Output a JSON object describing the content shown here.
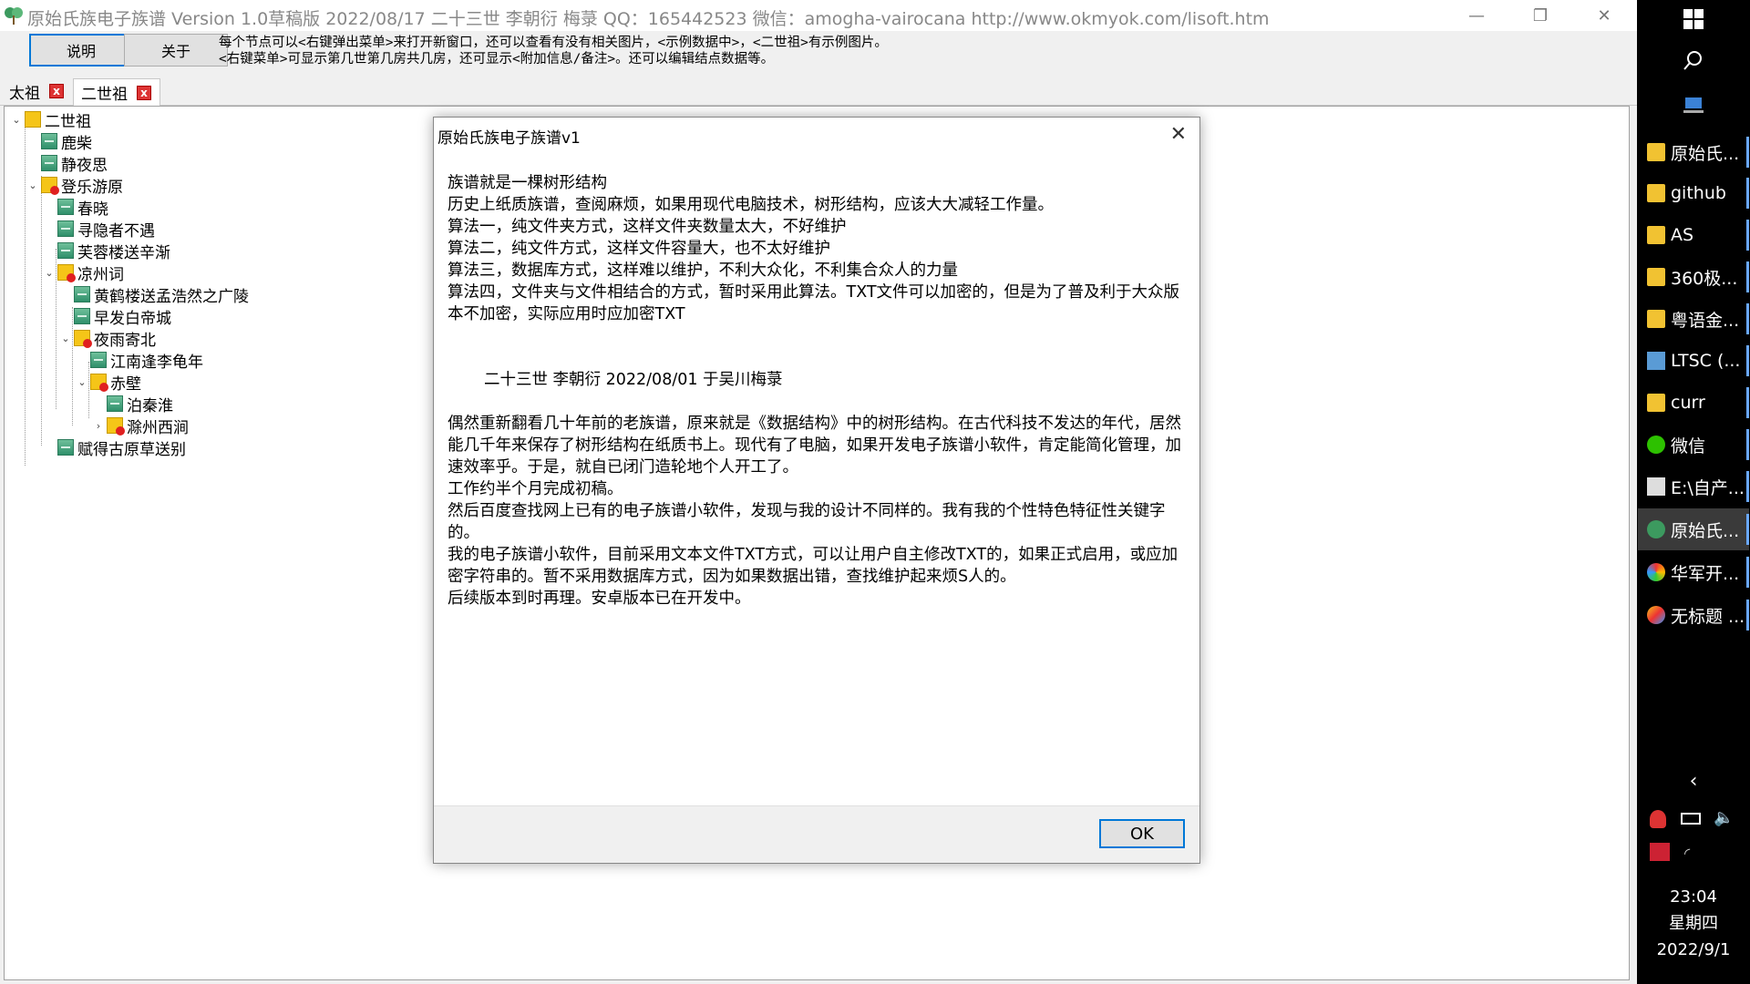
{
  "window": {
    "title": "原始氏族电子族谱    Version 1.0草稿版    2022/08/17 二十三世 李朝衍    梅菉    QQ：165442523    微信：amogha-vairocana    http://www.okmyok.com/lisoft.htm"
  },
  "toolbar": {
    "help_label": "说明",
    "about_label": "关于",
    "hint_line1": "每个节点可以<右键弹出菜单>来打开新窗口，还可以查看有没有相关图片，<示例数据中>，<二世祖>有示例图片。",
    "hint_line2": "<右键菜单>可显示第几世第几房共几房，还可显示<附加信息/备注>。还可以编辑结点数据等。"
  },
  "tabs": [
    {
      "label": "太祖",
      "close": "x"
    },
    {
      "label": "二世祖",
      "close": "x"
    }
  ],
  "tree": [
    {
      "label": "二世祖"
    },
    {
      "label": "鹿柴"
    },
    {
      "label": "静夜思"
    },
    {
      "label": "登乐游原"
    },
    {
      "label": "春晓"
    },
    {
      "label": "寻隐者不遇"
    },
    {
      "label": "芙蓉楼送辛渐"
    },
    {
      "label": "凉州词"
    },
    {
      "label": "黄鹤楼送孟浩然之广陵"
    },
    {
      "label": "早发白帝城"
    },
    {
      "label": "夜雨寄北"
    },
    {
      "label": "江南逢李龟年"
    },
    {
      "label": "赤壁"
    },
    {
      "label": "泊秦淮"
    },
    {
      "label": "滁州西涧"
    },
    {
      "label": "赋得古原草送别"
    }
  ],
  "dialog": {
    "title": "原始氏族电子族谱v1",
    "close_glyph": "✕",
    "lines": [
      "族谱就是一棵树形结构",
      "历史上纸质族谱，查阅麻烦，如果用现代电脑技术，树形结构，应该大大减轻工作量。",
      "算法一，纯文件夹方式，这样文件夹数量太大，不好维护",
      "算法二，纯文件方式，这样文件容量大，也不太好维护",
      "算法三，数据库方式，这样难以维护，不利大众化，不利集合众人的力量",
      "算法四，文件夹与文件相结合的方式，暂时采用此算法。TXT文件可以加密的，但是为了普及利于大众版本不加密，实际应用时应加密TXT"
    ],
    "signature": "二十三世  李朝衍   2022/08/01  于吴川梅菉",
    "para2": [
      "偶然重新翻看几十年前的老族谱，原来就是《数据结构》中的树形结构。在古代科技不发达的年代，居然能几千年来保存了树形结构在纸质书上。现代有了电脑，如果开发电子族谱小软件，肯定能简化管理，加速效率乎。于是，就自已闭门造轮地个人开工了。",
      "工作约半个月完成初稿。",
      "然后百度查找网上已有的电子族谱小软件，发现与我的设计不同样的。我有我的个性特色特征性关键字的。",
      "我的电子族谱小软件，目前采用文本文件TXT方式，可以让用户自主修改TXT的，如果正式启用，或应加密字符串的。暂不采用数据库方式，因为如果数据出错，查找维护起来烦S人的。",
      "后续版本到时再理。安卓版本已在开发中。"
    ],
    "ok_label": "OK"
  },
  "taskbar": {
    "items": [
      {
        "label": "原始氏..."
      },
      {
        "label": "github"
      },
      {
        "label": "AS"
      },
      {
        "label": "360极..."
      },
      {
        "label": "粤语金..."
      },
      {
        "label": "LTSC (..."
      },
      {
        "label": "curr"
      },
      {
        "label": "微信"
      },
      {
        "label": "E:\\自产..."
      },
      {
        "label": "原始氏..."
      },
      {
        "label": "华军开..."
      },
      {
        "label": "无标题 ..."
      }
    ],
    "clock": {
      "time": "23:04",
      "weekday": "星期四",
      "date": "2022/9/1"
    }
  }
}
